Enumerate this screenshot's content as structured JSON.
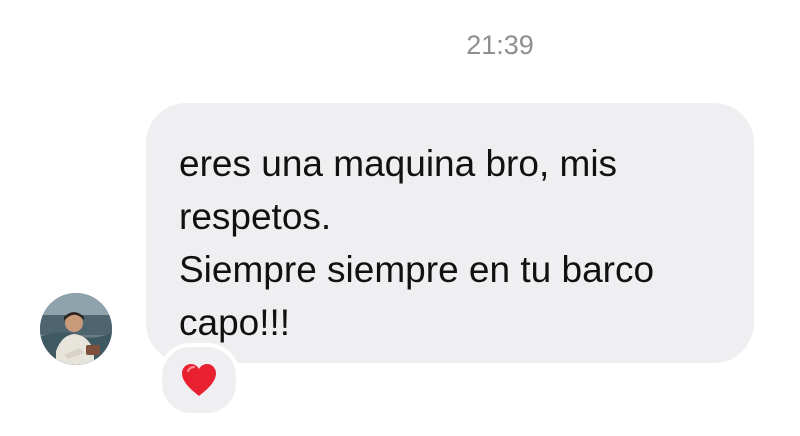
{
  "timestamp": "21:39",
  "message": {
    "lines": [
      "eres una maquina bro, mis",
      "respetos.",
      "Siempre siempre en tu barco",
      "capo!!!"
    ]
  },
  "reaction": {
    "icon": "heart-icon",
    "color": "#e8202f"
  },
  "avatar": {
    "icon": "profile-photo"
  },
  "colors": {
    "bubble": "#efeff1",
    "text": "#111111",
    "timestamp": "#8e8e93"
  }
}
